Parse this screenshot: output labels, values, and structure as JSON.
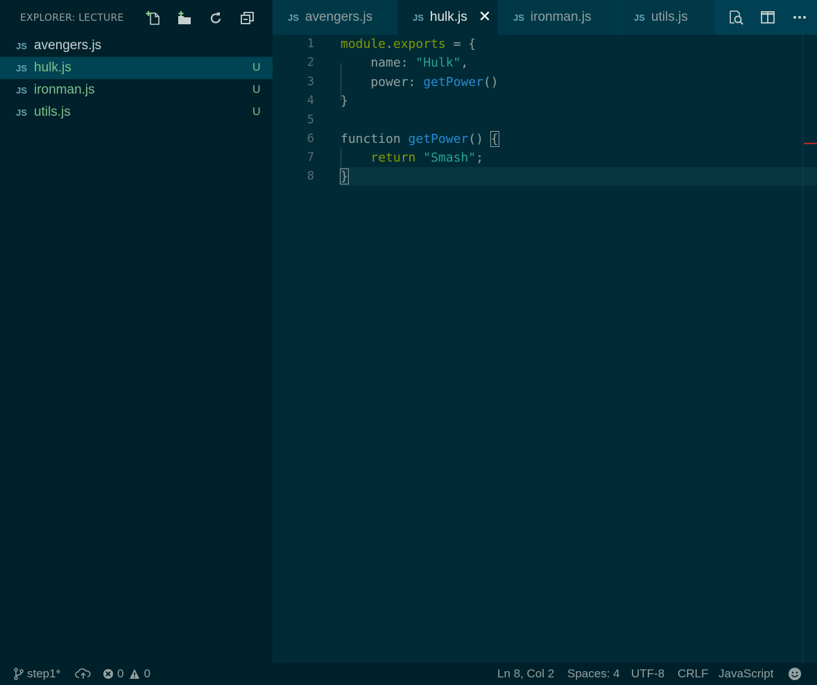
{
  "explorer": {
    "title": "EXPLORER: LECTURE",
    "actions": [
      "new-file-icon",
      "new-folder-icon",
      "refresh-icon",
      "collapse-all-icon"
    ],
    "files": [
      {
        "badge": "JS",
        "name": "avengers.js",
        "status": ""
      },
      {
        "badge": "JS",
        "name": "hulk.js",
        "status": "U"
      },
      {
        "badge": "JS",
        "name": "ironman.js",
        "status": "U"
      },
      {
        "badge": "JS",
        "name": "utils.js",
        "status": "U"
      }
    ]
  },
  "tabs": [
    {
      "badge": "JS",
      "name": "avengers.js"
    },
    {
      "badge": "JS",
      "name": "hulk.js",
      "close": "✕"
    },
    {
      "badge": "JS",
      "name": "ironman.js"
    },
    {
      "badge": "JS",
      "name": "utils.js"
    }
  ],
  "tab_actions": [
    "open-preview-icon",
    "split-editor-icon",
    "more-actions-icon"
  ],
  "editor": {
    "line_numbers": [
      "1",
      "2",
      "3",
      "4",
      "5",
      "6",
      "7",
      "8"
    ],
    "code": {
      "l1_a": "module",
      "l1_b": ".",
      "l1_c": "exports",
      "l1_d": " = {",
      "l2_a": "    name: ",
      "l2_b": "\"Hulk\"",
      "l2_c": ",",
      "l3_a": "    power: ",
      "l3_b": "getPower",
      "l3_c": "()",
      "l4": "}",
      "l5": "",
      "l6_a": "function ",
      "l6_b": "getPower",
      "l6_c": "() ",
      "l6_d": "{",
      "l7_a": "    ",
      "l7_b": "return",
      "l7_c": " ",
      "l7_d": "\"Smash\"",
      "l7_e": ";",
      "l8": "}"
    }
  },
  "statusbar": {
    "branch": "step1*",
    "errors": "0",
    "warnings": "0",
    "position": "Ln 8, Col 2",
    "spaces": "Spaces: 4",
    "encoding": "UTF-8",
    "eol": "CRLF",
    "language": "JavaScript"
  },
  "colors": {
    "sidebar_bg": "#00212b",
    "editor_bg": "#002b36",
    "untracked": "#7fbf8c",
    "function": "#268bd2",
    "string": "#2aa198",
    "keyword": "#859900"
  }
}
